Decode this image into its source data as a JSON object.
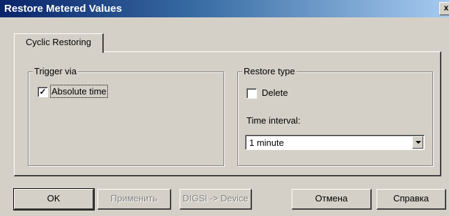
{
  "window": {
    "title": "Restore Metered Values",
    "close_label": "x"
  },
  "tabs": [
    {
      "label": "Cyclic Restoring",
      "active": true
    }
  ],
  "trigger_group": {
    "legend": "Trigger via",
    "absolute_time": {
      "label": "Absolute time",
      "checked": true
    }
  },
  "restore_group": {
    "legend": "Restore type",
    "delete": {
      "label": "Delete",
      "checked": false
    },
    "time_interval_label": "Time interval:",
    "time_interval_value": "1 minute"
  },
  "buttons": {
    "ok": "OK",
    "apply": "Применить",
    "digsi": "DIGSI -> Device",
    "cancel": "Отмена",
    "help": "Справка"
  }
}
